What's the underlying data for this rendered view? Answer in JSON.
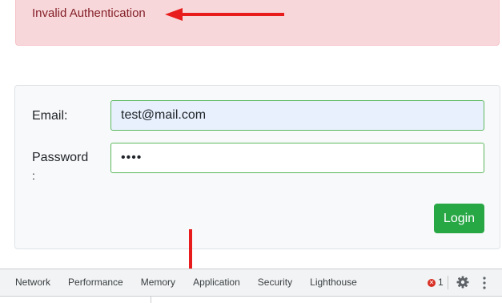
{
  "alert": {
    "message": "Invalid Authentication"
  },
  "login_form": {
    "email_label": "Email:",
    "email_value": "test@mail.com",
    "password_label": "Password",
    "password_label_colon": ":",
    "password_value": "••••",
    "login_button": "Login"
  },
  "devtools": {
    "tabs": [
      {
        "label": "Network"
      },
      {
        "label": "Performance"
      },
      {
        "label": "Memory"
      },
      {
        "label": "Application"
      },
      {
        "label": "Security"
      },
      {
        "label": "Lighthouse"
      }
    ],
    "error_icon_glyph": "✕",
    "error_count": "1",
    "icons": [
      "error-icon",
      "gear-icon",
      "kebab-menu-icon"
    ]
  },
  "annotations": {
    "arrow_color": "#e81c1c"
  },
  "colors": {
    "alert_bg": "#f8d7da",
    "alert_text": "#842029",
    "input_border": "#5cb85c",
    "button_bg": "#28a745"
  }
}
